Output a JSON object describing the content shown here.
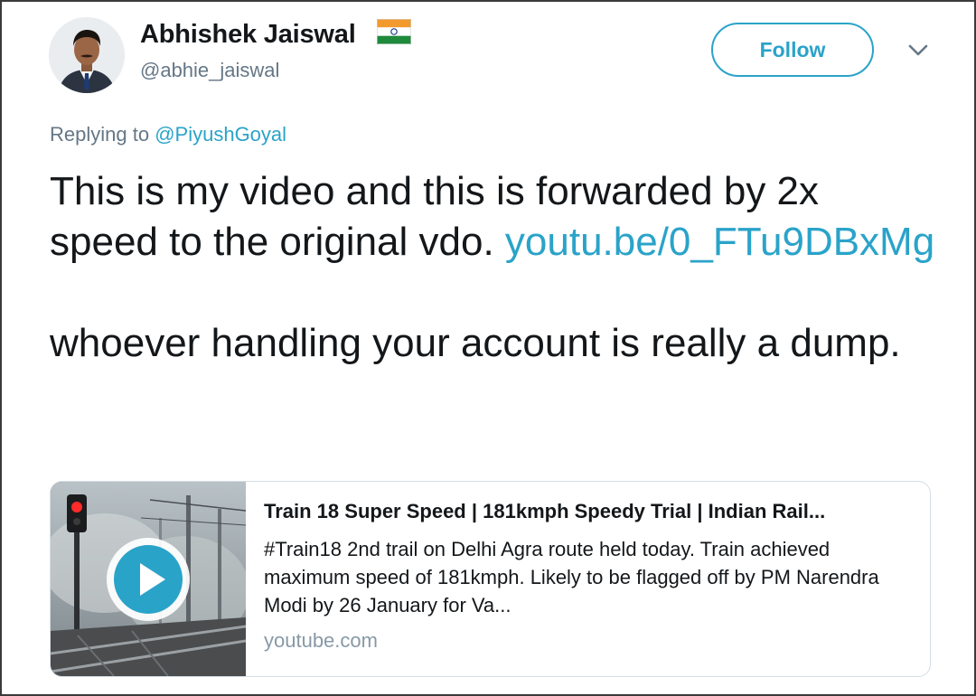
{
  "user": {
    "display_name": "Abhishek Jaiswal",
    "handle": "@abhie_jaiswal",
    "avatar": "profile-photo",
    "flag": "india-flag-emoji"
  },
  "actions": {
    "follow_label": "Follow",
    "menu_icon": "chevron-down-icon"
  },
  "reply": {
    "prefix": "Replying to",
    "mention": "@PiyushGoyal"
  },
  "tweet": {
    "text_part1": "This is my video and this is forwarded by 2x speed to the original vdo. ",
    "link_text": "youtu.be/0_FTu9DBxMg",
    "text_part2": "whoever handling your account is really a dump."
  },
  "card": {
    "title": "Train 18 Super Speed | 181kmph Speedy Trial | Indian Rail...",
    "description": "#Train18 2nd trail on Delhi Agra route held today. Train achieved maximum speed of 181kmph. Likely to be flagged off by PM Narendra Modi by 26 January for Va...",
    "domain": "youtube.com",
    "thumbnail_icon": "play-icon"
  },
  "colors": {
    "accent": "#2aa3c9",
    "text": "#14171a",
    "secondary": "#657786",
    "border": "#d5dde3"
  }
}
